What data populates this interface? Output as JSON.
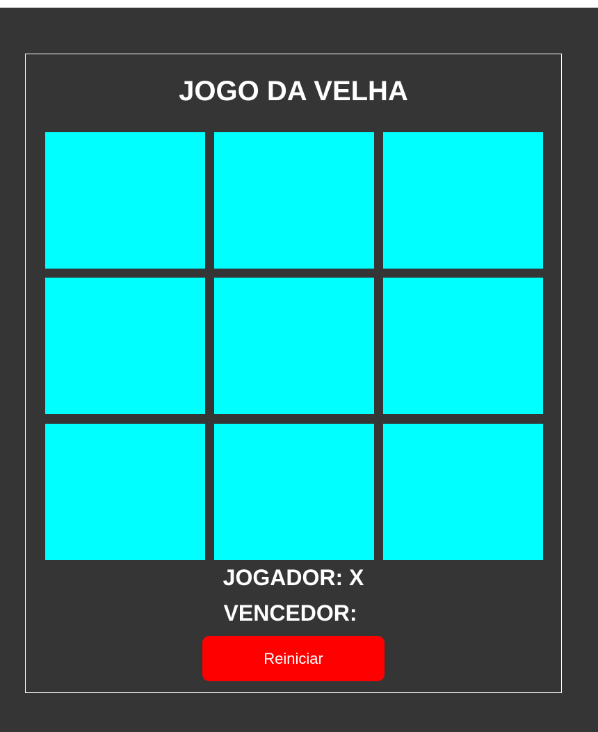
{
  "game": {
    "title": "JOGO DA VELHA",
    "board": [
      "",
      "",
      "",
      "",
      "",
      "",
      "",
      "",
      ""
    ],
    "player_label": "JOGADOR:",
    "player_value": "X",
    "winner_label": "VENCEDOR:",
    "winner_value": "",
    "restart_label": "Reiniciar"
  },
  "colors": {
    "background": "#353535",
    "cell": "#00ffff",
    "button": "#ff0000",
    "text": "#ffffff"
  }
}
